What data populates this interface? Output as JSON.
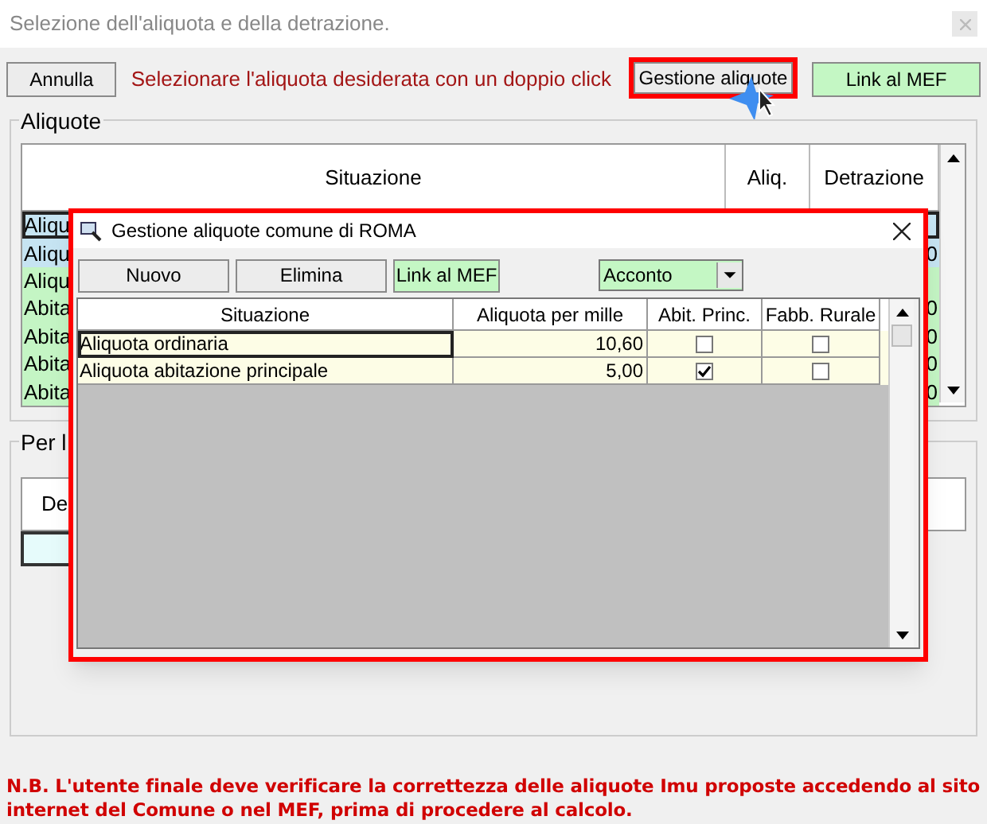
{
  "window": {
    "title": "Selezione dell'aliquota e della detrazione."
  },
  "toolbar": {
    "cancel": {
      "label": "Annulla",
      "highlighted": false
    },
    "hint": "Selezionare l'aliquota desiderata con un doppio click",
    "buttons": [
      {
        "label": "Gestione aliquote",
        "kind": "plain",
        "highlighted": true
      },
      {
        "label": "Link al MEF",
        "kind": "green",
        "highlighted": false
      }
    ]
  },
  "aliquote": {
    "title": "Aliquote",
    "columns": [
      "Situazione",
      "Aliq.",
      "Detrazione"
    ],
    "rows": [
      {
        "situazione": "Aliqu",
        "selected": true,
        "color": "#c6e4f2"
      },
      {
        "situazione": "Aliqu",
        "detrazione": "0",
        "selected": false,
        "color": "#c6e4f2"
      },
      {
        "situazione": "Aliqu",
        "selected": false,
        "color": "#c4f5c4"
      },
      {
        "situazione": "Abita",
        "detrazione": "0",
        "selected": false,
        "color": "#c4f5c4"
      },
      {
        "situazione": "Abita",
        "detrazione": "0",
        "selected": false,
        "color": "#c4f5c4"
      },
      {
        "situazione": "Abita",
        "detrazione": "0",
        "selected": false,
        "color": "#c4f5c4"
      },
      {
        "situazione": "Abita",
        "detrazione": "0",
        "selected": false,
        "color": "#c4f5c4"
      }
    ]
  },
  "detrazione_group": {
    "title": "Per l",
    "column_1": "De"
  },
  "dialog": {
    "title": "Gestione aliquote comune di ROMA",
    "highlighted": true,
    "buttons": [
      {
        "label": "Nuovo",
        "kind": "plain"
      },
      {
        "label": "Elimina",
        "kind": "plain"
      },
      {
        "label": "Link al MEF",
        "kind": "green"
      }
    ],
    "period_select": {
      "value": "Acconto"
    },
    "columns": [
      "Situazione",
      "Aliquota per mille",
      "Abit. Princ.",
      "Fabb. Rurale"
    ],
    "rows": [
      {
        "situazione": "Aliquota ordinaria",
        "aliquota": "10,60",
        "abit_princ": false,
        "fabb_rurale": false,
        "selected": true
      },
      {
        "situazione": "Aliquota abitazione principale",
        "aliquota": "5,00",
        "abit_princ": true,
        "fabb_rurale": false,
        "selected": false
      }
    ]
  },
  "note": "N.B. L'utente finale deve verificare la correttezza delle aliquote Imu proposte accedendo al sito internet del Comune o nel MEF, prima di procedere al calcolo."
}
